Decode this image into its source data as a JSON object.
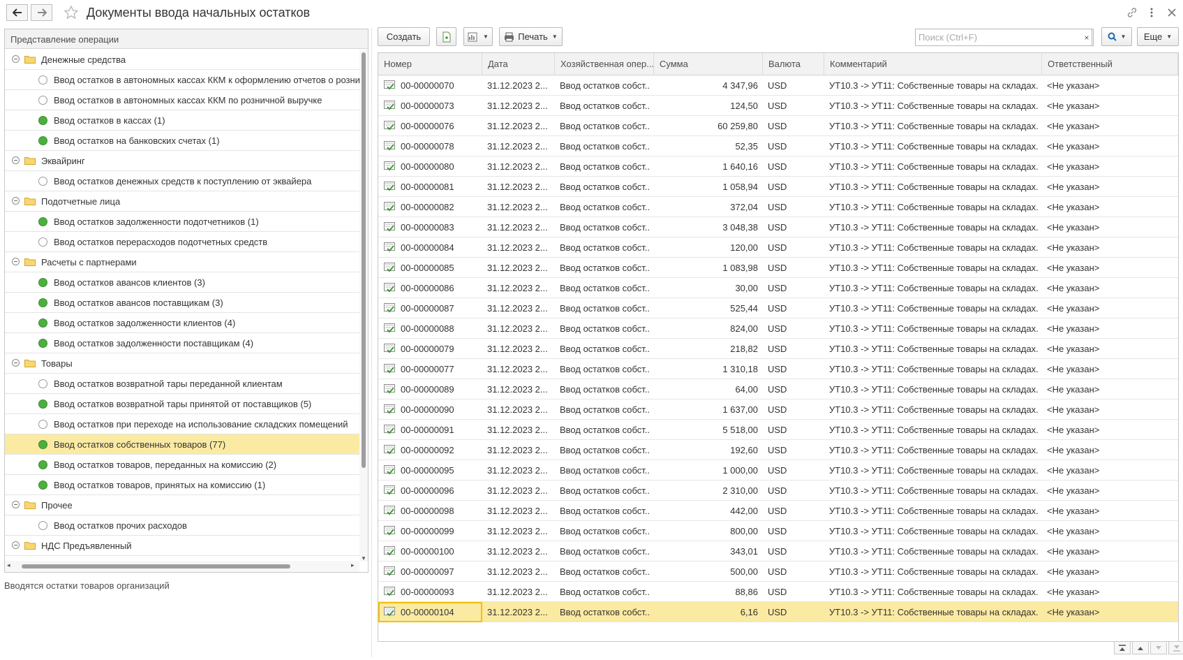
{
  "window": {
    "title": "Документы ввода начальных остатков",
    "back_icon": "arrow-left-icon",
    "forward_icon": "arrow-right-icon",
    "favorite_icon": "star-icon",
    "link_icon": "link-icon",
    "menu_icon": "more-vertical-icon",
    "close_icon": "close-icon"
  },
  "tree": {
    "header": "Представление операции",
    "description": "Вводятся остатки товаров организаций",
    "rows": [
      {
        "type": "group",
        "label": "Денежные средства"
      },
      {
        "type": "item",
        "label": "Ввод остатков в автономных кассах ККМ к оформлению отчетов о розничных продажах",
        "active": false
      },
      {
        "type": "item",
        "label": "Ввод остатков в автономных кассах ККМ по розничной выручке",
        "active": false
      },
      {
        "type": "item",
        "label": "Ввод остатков в кассах (1)",
        "active": true
      },
      {
        "type": "item",
        "label": "Ввод остатков на банковских счетах (1)",
        "active": true
      },
      {
        "type": "group",
        "label": "Эквайринг"
      },
      {
        "type": "item",
        "label": "Ввод остатков денежных средств к поступлению от эквайера",
        "active": false
      },
      {
        "type": "group",
        "label": "Подотчетные лица"
      },
      {
        "type": "item",
        "label": "Ввод остатков задолженности подотчетников (1)",
        "active": true
      },
      {
        "type": "item",
        "label": "Ввод остатков перерасходов подотчетных средств",
        "active": false
      },
      {
        "type": "group",
        "label": "Расчеты с партнерами"
      },
      {
        "type": "item",
        "label": "Ввод остатков авансов клиентов (3)",
        "active": true
      },
      {
        "type": "item",
        "label": "Ввод остатков авансов поставщикам (3)",
        "active": true
      },
      {
        "type": "item",
        "label": "Ввод остатков задолженности клиентов (4)",
        "active": true
      },
      {
        "type": "item",
        "label": "Ввод остатков задолженности поставщикам (4)",
        "active": true
      },
      {
        "type": "group",
        "label": "Товары"
      },
      {
        "type": "item",
        "label": "Ввод остатков возвратной тары переданной клиентам",
        "active": false
      },
      {
        "type": "item",
        "label": "Ввод остатков возвратной тары принятой от поставщиков (5)",
        "active": true
      },
      {
        "type": "item",
        "label": "Ввод остатков при переходе на использование складских помещений",
        "active": false
      },
      {
        "type": "item",
        "label": "Ввод остатков собственных товаров (77)",
        "active": true,
        "selected": true
      },
      {
        "type": "item",
        "label": "Ввод остатков товаров, переданных на комиссию (2)",
        "active": true
      },
      {
        "type": "item",
        "label": "Ввод остатков товаров, принятых на комиссию (1)",
        "active": true
      },
      {
        "type": "group",
        "label": "Прочее"
      },
      {
        "type": "item",
        "label": "Ввод остатков прочих расходов",
        "active": false
      },
      {
        "type": "group",
        "label": "НДС Предъявленный"
      }
    ]
  },
  "toolbar": {
    "create_label": "Создать",
    "print_label": "Печать",
    "more_label": "Еще",
    "search_placeholder": "Поиск (Ctrl+F)",
    "clear_label": "×"
  },
  "table": {
    "columns": [
      "Номер",
      "Дата",
      "Хозяйственная опер...",
      "Сумма",
      "Валюта",
      "Комментарий",
      "Ответственный"
    ],
    "rows": [
      {
        "number": "00-00000070",
        "date": "31.12.2023 2...",
        "op": "Ввод остатков собст...",
        "sum": "4 347,96",
        "currency": "USD",
        "comment": "УТ10.3 -> УТ11: Собственные товары на складах. ...",
        "responsible": "<Не указан>"
      },
      {
        "number": "00-00000073",
        "date": "31.12.2023 2...",
        "op": "Ввод остатков собст...",
        "sum": "124,50",
        "currency": "USD",
        "comment": "УТ10.3 -> УТ11: Собственные товары на складах. ...",
        "responsible": "<Не указан>"
      },
      {
        "number": "00-00000076",
        "date": "31.12.2023 2...",
        "op": "Ввод остатков собст...",
        "sum": "60 259,80",
        "currency": "USD",
        "comment": "УТ10.3 -> УТ11: Собственные товары на складах. ...",
        "responsible": "<Не указан>"
      },
      {
        "number": "00-00000078",
        "date": "31.12.2023 2...",
        "op": "Ввод остатков собст...",
        "sum": "52,35",
        "currency": "USD",
        "comment": "УТ10.3 -> УТ11: Собственные товары на складах. ...",
        "responsible": "<Не указан>"
      },
      {
        "number": "00-00000080",
        "date": "31.12.2023 2...",
        "op": "Ввод остатков собст...",
        "sum": "1 640,16",
        "currency": "USD",
        "comment": "УТ10.3 -> УТ11: Собственные товары на складах. ...",
        "responsible": "<Не указан>"
      },
      {
        "number": "00-00000081",
        "date": "31.12.2023 2...",
        "op": "Ввод остатков собст...",
        "sum": "1 058,94",
        "currency": "USD",
        "comment": "УТ10.3 -> УТ11: Собственные товары на складах. ...",
        "responsible": "<Не указан>"
      },
      {
        "number": "00-00000082",
        "date": "31.12.2023 2...",
        "op": "Ввод остатков собст...",
        "sum": "372,04",
        "currency": "USD",
        "comment": "УТ10.3 -> УТ11: Собственные товары на складах. ...",
        "responsible": "<Не указан>"
      },
      {
        "number": "00-00000083",
        "date": "31.12.2023 2...",
        "op": "Ввод остатков собст...",
        "sum": "3 048,38",
        "currency": "USD",
        "comment": "УТ10.3 -> УТ11: Собственные товары на складах. ...",
        "responsible": "<Не указан>"
      },
      {
        "number": "00-00000084",
        "date": "31.12.2023 2...",
        "op": "Ввод остатков собст...",
        "sum": "120,00",
        "currency": "USD",
        "comment": "УТ10.3 -> УТ11: Собственные товары на складах. ...",
        "responsible": "<Не указан>"
      },
      {
        "number": "00-00000085",
        "date": "31.12.2023 2...",
        "op": "Ввод остатков собст...",
        "sum": "1 083,98",
        "currency": "USD",
        "comment": "УТ10.3 -> УТ11: Собственные товары на складах. ...",
        "responsible": "<Не указан>"
      },
      {
        "number": "00-00000086",
        "date": "31.12.2023 2...",
        "op": "Ввод остатков собст...",
        "sum": "30,00",
        "currency": "USD",
        "comment": "УТ10.3 -> УТ11: Собственные товары на складах. ...",
        "responsible": "<Не указан>"
      },
      {
        "number": "00-00000087",
        "date": "31.12.2023 2...",
        "op": "Ввод остатков собст...",
        "sum": "525,44",
        "currency": "USD",
        "comment": "УТ10.3 -> УТ11: Собственные товары на складах. ...",
        "responsible": "<Не указан>"
      },
      {
        "number": "00-00000088",
        "date": "31.12.2023 2...",
        "op": "Ввод остатков собст...",
        "sum": "824,00",
        "currency": "USD",
        "comment": "УТ10.3 -> УТ11: Собственные товары на складах. ...",
        "responsible": "<Не указан>"
      },
      {
        "number": "00-00000079",
        "date": "31.12.2023 2...",
        "op": "Ввод остатков собст...",
        "sum": "218,82",
        "currency": "USD",
        "comment": "УТ10.3 -> УТ11: Собственные товары на складах. ...",
        "responsible": "<Не указан>"
      },
      {
        "number": "00-00000077",
        "date": "31.12.2023 2...",
        "op": "Ввод остатков собст...",
        "sum": "1 310,18",
        "currency": "USD",
        "comment": "УТ10.3 -> УТ11: Собственные товары на складах. ...",
        "responsible": "<Не указан>"
      },
      {
        "number": "00-00000089",
        "date": "31.12.2023 2...",
        "op": "Ввод остатков собст...",
        "sum": "64,00",
        "currency": "USD",
        "comment": "УТ10.3 -> УТ11: Собственные товары на складах. ...",
        "responsible": "<Не указан>"
      },
      {
        "number": "00-00000090",
        "date": "31.12.2023 2...",
        "op": "Ввод остатков собст...",
        "sum": "1 637,00",
        "currency": "USD",
        "comment": "УТ10.3 -> УТ11: Собственные товары на складах. ...",
        "responsible": "<Не указан>"
      },
      {
        "number": "00-00000091",
        "date": "31.12.2023 2...",
        "op": "Ввод остатков собст...",
        "sum": "5 518,00",
        "currency": "USD",
        "comment": "УТ10.3 -> УТ11: Собственные товары на складах. ...",
        "responsible": "<Не указан>"
      },
      {
        "number": "00-00000092",
        "date": "31.12.2023 2...",
        "op": "Ввод остатков собст...",
        "sum": "192,60",
        "currency": "USD",
        "comment": "УТ10.3 -> УТ11: Собственные товары на складах. ...",
        "responsible": "<Не указан>"
      },
      {
        "number": "00-00000095",
        "date": "31.12.2023 2...",
        "op": "Ввод остатков собст...",
        "sum": "1 000,00",
        "currency": "USD",
        "comment": "УТ10.3 -> УТ11: Собственные товары на складах. ...",
        "responsible": "<Не указан>"
      },
      {
        "number": "00-00000096",
        "date": "31.12.2023 2...",
        "op": "Ввод остатков собст...",
        "sum": "2 310,00",
        "currency": "USD",
        "comment": "УТ10.3 -> УТ11: Собственные товары на складах. ...",
        "responsible": "<Не указан>"
      },
      {
        "number": "00-00000098",
        "date": "31.12.2023 2...",
        "op": "Ввод остатков собст...",
        "sum": "442,00",
        "currency": "USD",
        "comment": "УТ10.3 -> УТ11: Собственные товары на складах. ...",
        "responsible": "<Не указан>"
      },
      {
        "number": "00-00000099",
        "date": "31.12.2023 2...",
        "op": "Ввод остатков собст...",
        "sum": "800,00",
        "currency": "USD",
        "comment": "УТ10.3 -> УТ11: Собственные товары на складах. ...",
        "responsible": "<Не указан>"
      },
      {
        "number": "00-00000100",
        "date": "31.12.2023 2...",
        "op": "Ввод остатков собст...",
        "sum": "343,01",
        "currency": "USD",
        "comment": "УТ10.3 -> УТ11: Собственные товары на складах. ...",
        "responsible": "<Не указан>"
      },
      {
        "number": "00-00000097",
        "date": "31.12.2023 2...",
        "op": "Ввод остатков собст...",
        "sum": "500,00",
        "currency": "USD",
        "comment": "УТ10.3 -> УТ11: Собственные товары на складах. ...",
        "responsible": "<Не указан>"
      },
      {
        "number": "00-00000093",
        "date": "31.12.2023 2...",
        "op": "Ввод остатков собст...",
        "sum": "88,86",
        "currency": "USD",
        "comment": "УТ10.3 -> УТ11: Собственные товары на складах. ...",
        "responsible": "<Не указан>"
      },
      {
        "number": "00-00000104",
        "date": "31.12.2023 2...",
        "op": "Ввод остатков собст...",
        "sum": "6,16",
        "currency": "USD",
        "comment": "УТ10.3 -> УТ11: Собственные товары на складах. ...",
        "responsible": "<Не указан>",
        "selected": true
      }
    ]
  },
  "colors": {
    "selection": "#fbeaa2",
    "active_dot": "#4caf3f",
    "folder": "#f2c94c"
  }
}
